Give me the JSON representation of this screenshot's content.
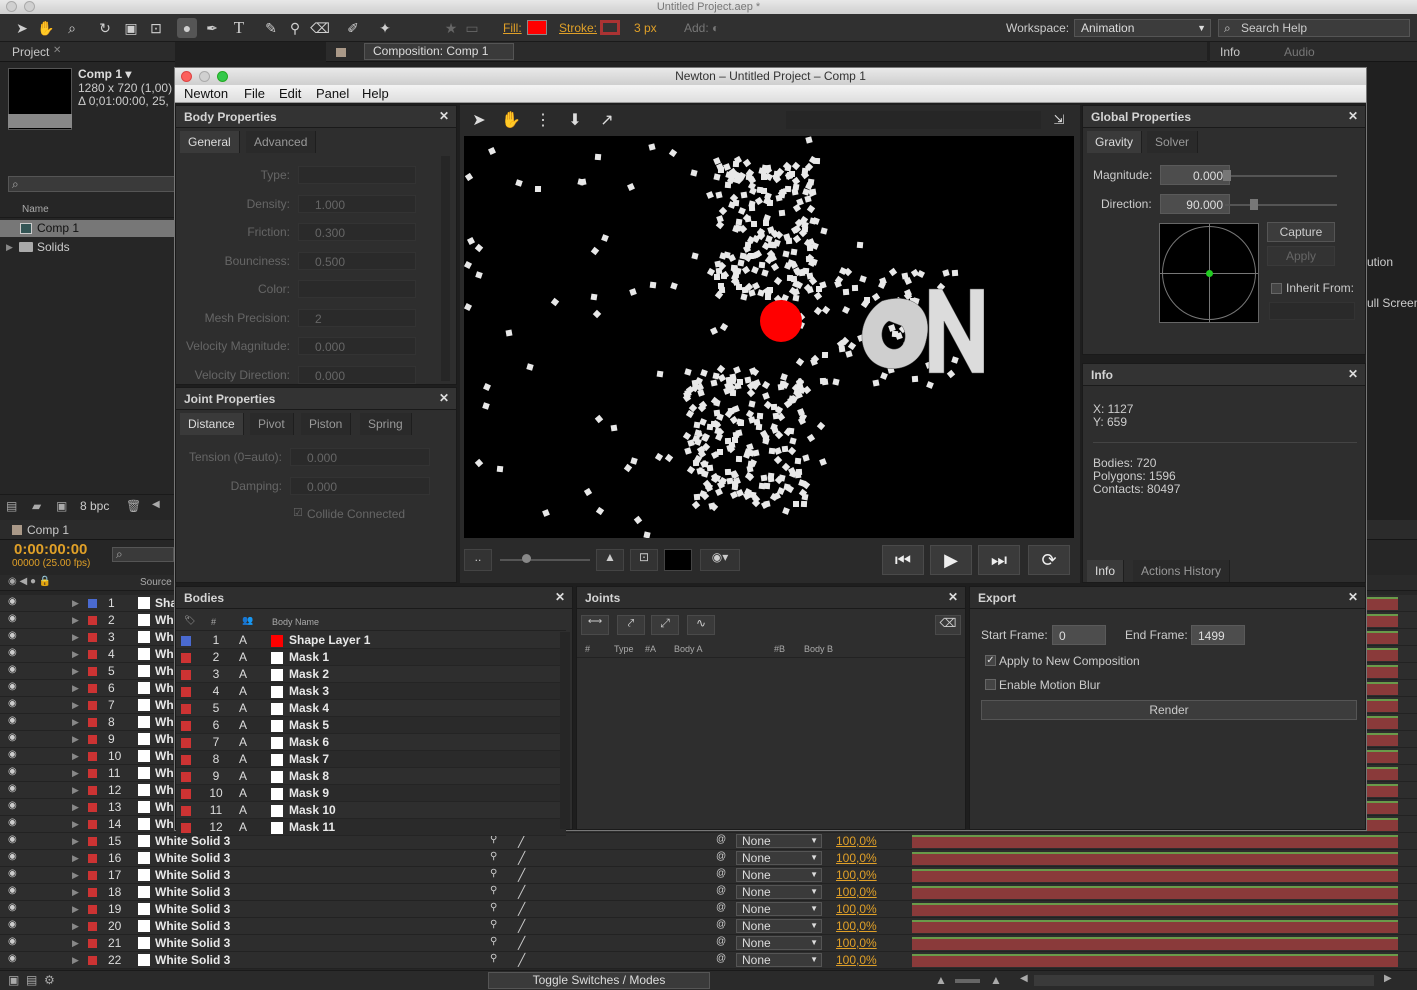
{
  "app": {
    "window_title": "Untitled Project.aep *"
  },
  "toolbar": {
    "fill_label": "Fill:",
    "stroke_label": "Stroke:",
    "stroke_width": "3 px",
    "add_label": "Add:",
    "workspace_label": "Workspace:",
    "workspace_value": "Animation",
    "search_placeholder": "Search Help",
    "fill_color": "#ff0000"
  },
  "project_panel": {
    "tab": "Project",
    "comp_name": "Comp 1 ▾",
    "comp_size": "1280 x 720 (1,00)",
    "comp_duration": "Δ 0;01:00:00, 25,",
    "column_name": "Name",
    "items": [
      {
        "name": "Comp 1",
        "icon": "composition-icon"
      },
      {
        "name": "Solids",
        "icon": "folder-icon"
      }
    ],
    "bpc": "8 bpc"
  },
  "comp_viewer_tab": "Composition: Comp 1",
  "right_panels": {
    "info_tab": "Info",
    "audio_tab": "Audio",
    "ution": "ution",
    "full_screen": "ull Screen"
  },
  "timeline": {
    "tab": "Comp 1",
    "timecode": "0:00:00:00",
    "fps": "00000 (25.00 fps)",
    "source_header": "Source",
    "toggle_label": "Toggle Switches / Modes",
    "layers": [
      {
        "num": "1",
        "name": "Sha",
        "color": "#4a6ad0"
      },
      {
        "num": "2",
        "name": "Wh",
        "color": "#c33"
      },
      {
        "num": "3",
        "name": "Wh",
        "color": "#c33"
      },
      {
        "num": "4",
        "name": "Wh",
        "color": "#c33"
      },
      {
        "num": "5",
        "name": "Wh",
        "color": "#c33"
      },
      {
        "num": "6",
        "name": "Wh",
        "color": "#c33"
      },
      {
        "num": "7",
        "name": "Wh",
        "color": "#c33"
      },
      {
        "num": "8",
        "name": "Wh",
        "color": "#c33"
      },
      {
        "num": "9",
        "name": "Wh",
        "color": "#c33"
      },
      {
        "num": "10",
        "name": "Wh",
        "color": "#c33"
      },
      {
        "num": "11",
        "name": "Wh",
        "color": "#c33"
      },
      {
        "num": "12",
        "name": "Wh",
        "color": "#c33"
      },
      {
        "num": "13",
        "name": "Wh",
        "color": "#c33"
      },
      {
        "num": "14",
        "name": "Wh",
        "color": "#c33"
      },
      {
        "num": "15",
        "name": "White Solid 3",
        "mode": "None",
        "pct": "100,0%"
      },
      {
        "num": "16",
        "name": "White Solid 3",
        "mode": "None",
        "pct": "100,0%"
      },
      {
        "num": "17",
        "name": "White Solid 3",
        "mode": "None",
        "pct": "100,0%"
      },
      {
        "num": "18",
        "name": "White Solid 3",
        "mode": "None",
        "pct": "100,0%"
      },
      {
        "num": "19",
        "name": "White Solid 3",
        "mode": "None",
        "pct": "100,0%"
      },
      {
        "num": "20",
        "name": "White Solid 3",
        "mode": "None",
        "pct": "100,0%"
      },
      {
        "num": "21",
        "name": "White Solid 3",
        "mode": "None",
        "pct": "100,0%"
      },
      {
        "num": "22",
        "name": "White Solid 3",
        "mode": "None",
        "pct": "100,0%"
      }
    ]
  },
  "newton": {
    "title": "Newton – Untitled Project – Comp 1",
    "menu": [
      "Newton",
      "File",
      "Edit",
      "Panel",
      "Help"
    ],
    "body_properties": {
      "title": "Body Properties",
      "tabs": [
        "General",
        "Advanced"
      ],
      "fields": [
        {
          "label": "Type:",
          "value": ""
        },
        {
          "label": "Density:",
          "value": "1.000"
        },
        {
          "label": "Friction:",
          "value": "0.300"
        },
        {
          "label": "Bounciness:",
          "value": "0.500"
        },
        {
          "label": "Color:",
          "value": ""
        },
        {
          "label": "Mesh Precision:",
          "value": "2"
        },
        {
          "label": "Velocity Magnitude:",
          "value": "0.000"
        },
        {
          "label": "Velocity Direction:",
          "value": "0.000"
        }
      ]
    },
    "joint_properties": {
      "title": "Joint Properties",
      "tabs": [
        "Distance",
        "Pivot",
        "Piston",
        "Spring"
      ],
      "fields": [
        {
          "label": "Tension (0=auto):",
          "value": "0.000"
        },
        {
          "label": "Damping:",
          "value": "0.000"
        }
      ],
      "collide": "Collide Connected"
    },
    "global_properties": {
      "title": "Global Properties",
      "tabs": [
        "Gravity",
        "Solver"
      ],
      "magnitude_label": "Magnitude:",
      "magnitude": "0.000",
      "direction_label": "Direction:",
      "direction": "90.000",
      "capture": "Capture",
      "apply": "Apply",
      "inherit": "Inherit From:"
    },
    "info": {
      "title": "Info",
      "x": "X: 1127",
      "y": "Y: 659",
      "bodies": "Bodies: 720",
      "polygons": "Polygons: 1596",
      "contacts": "Contacts: 80497",
      "tabs": [
        "Info",
        "Actions History"
      ]
    },
    "bodies": {
      "title": "Bodies",
      "headers": [
        "#",
        "Body Name"
      ],
      "rows": [
        {
          "num": "1",
          "type": "A",
          "name": "Shape Layer 1",
          "color": "#4a6ad0",
          "swatch": "#ff0000"
        },
        {
          "num": "2",
          "type": "A",
          "name": "Mask 1",
          "color": "#c33",
          "swatch": "#ffffff"
        },
        {
          "num": "3",
          "type": "A",
          "name": "Mask 2",
          "color": "#c33",
          "swatch": "#ffffff"
        },
        {
          "num": "4",
          "type": "A",
          "name": "Mask 3",
          "color": "#c33",
          "swatch": "#ffffff"
        },
        {
          "num": "5",
          "type": "A",
          "name": "Mask 4",
          "color": "#c33",
          "swatch": "#ffffff"
        },
        {
          "num": "6",
          "type": "A",
          "name": "Mask 5",
          "color": "#c33",
          "swatch": "#ffffff"
        },
        {
          "num": "7",
          "type": "A",
          "name": "Mask 6",
          "color": "#c33",
          "swatch": "#ffffff"
        },
        {
          "num": "8",
          "type": "A",
          "name": "Mask 7",
          "color": "#c33",
          "swatch": "#ffffff"
        },
        {
          "num": "9",
          "type": "A",
          "name": "Mask 8",
          "color": "#c33",
          "swatch": "#ffffff"
        },
        {
          "num": "10",
          "type": "A",
          "name": "Mask 9",
          "color": "#c33",
          "swatch": "#ffffff"
        },
        {
          "num": "11",
          "type": "A",
          "name": "Mask 10",
          "color": "#c33",
          "swatch": "#ffffff"
        },
        {
          "num": "12",
          "type": "A",
          "name": "Mask 11",
          "color": "#c33",
          "swatch": "#ffffff"
        }
      ]
    },
    "joints": {
      "title": "Joints",
      "headers": [
        "#",
        "Type",
        "#A",
        "Body A",
        "#B",
        "Body B"
      ]
    },
    "export": {
      "title": "Export",
      "start_label": "Start Frame:",
      "start": "0",
      "end_label": "End Frame:",
      "end": "1499",
      "apply_new": "Apply to New Composition",
      "motion_blur": "Enable Motion Blur",
      "render": "Render"
    }
  }
}
